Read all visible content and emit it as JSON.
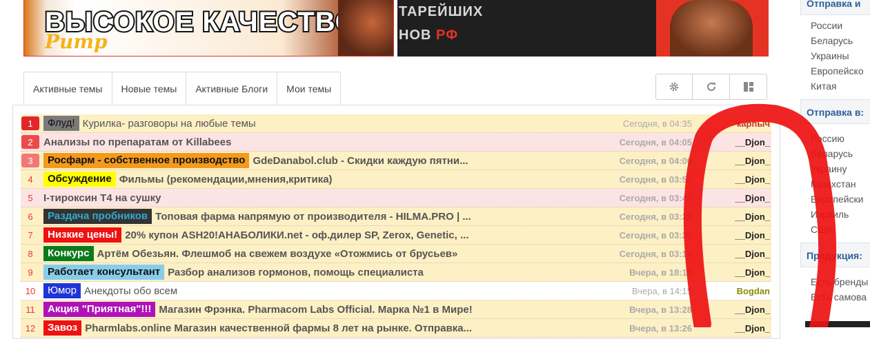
{
  "banners": {
    "left": {
      "headline": "ВЫСОКОЕ КАЧЕСТВО",
      "logo": "Pump"
    },
    "right": {
      "line1": "ТАРЕЙШИХ",
      "line2": "НОВ",
      "line2_accent": "РФ"
    }
  },
  "tabs": [
    {
      "label": "Активные темы",
      "active": true
    },
    {
      "label": "Новые темы",
      "active": false
    },
    {
      "label": "Активные Блоги",
      "active": false
    },
    {
      "label": "Мои темы",
      "active": false
    }
  ],
  "toolbar": [
    "gear-icon",
    "refresh-icon",
    "layout-icon"
  ],
  "topics": [
    {
      "num": "1",
      "num_style": "red1",
      "row": "yellow",
      "badge": "Флуд!",
      "badge_bg": "#7a7a7a",
      "badge_fg": "#111111",
      "badge_bold": false,
      "title": "Курилка- разговоры на любые темы",
      "title_bold": false,
      "time": "Сегодня, в 04:35",
      "time_bold": false,
      "user": "карпыч",
      "user_color": "#c0392b"
    },
    {
      "num": "2",
      "num_style": "red2",
      "row": "pink",
      "badge": "",
      "title": "Анализы по препаратам от Killabees",
      "title_bold": true,
      "time": "Сегодня, в 04:05",
      "time_bold": true,
      "user": "__Djon_",
      "user_color": "#222222"
    },
    {
      "num": "3",
      "num_style": "red3",
      "row": "yellow",
      "badge": "Росфарм - собственное производство",
      "badge_bg": "#f39a1e",
      "badge_fg": "#111111",
      "badge_bold": true,
      "title": "GdeDanabol.club - Скидки каждую пятни...",
      "title_bold": true,
      "time": "Сегодня, в 04:00",
      "time_bold": true,
      "user": "__Djon_",
      "user_color": "#222222"
    },
    {
      "num": "4",
      "num_style": "plain",
      "row": "yellow",
      "badge": "Обсуждение",
      "badge_bg": "#ffff00",
      "badge_fg": "#111111",
      "badge_bold": true,
      "title": "Фильмы (рекомендации,мнения,критика)",
      "title_bold": true,
      "time": "Сегодня, в 03:53",
      "time_bold": true,
      "user": "__Djon_",
      "user_color": "#222222"
    },
    {
      "num": "5",
      "num_style": "plain",
      "row": "pink",
      "badge": "",
      "title": "I-тироксин Т4 на сушку",
      "title_bold": true,
      "time": "Сегодня, в 03:48",
      "time_bold": true,
      "user": "__Djon_",
      "user_color": "#222222"
    },
    {
      "num": "6",
      "num_style": "plain",
      "row": "yellow",
      "badge": "Раздача пробников",
      "badge_bg": "#333333",
      "badge_fg": "#33aacc",
      "badge_bold": true,
      "title": "Топовая фарма напрямую от производителя - HILMA.PRO | ...",
      "title_bold": true,
      "time": "Сегодня, в 03:32",
      "time_bold": true,
      "user": "__Djon_",
      "user_color": "#222222"
    },
    {
      "num": "7",
      "num_style": "plain",
      "row": "yellow",
      "badge": "Низкие цены!",
      "badge_bg": "#ee1111",
      "badge_fg": "#ffffff",
      "badge_bold": true,
      "title": "20% купон ASH20!АНАБОЛИКИ.net - оф.дилер SP, Zerox, Genetic, ...",
      "title_bold": true,
      "time": "Сегодня, в 03:28",
      "time_bold": true,
      "user": "__Djon_",
      "user_color": "#222222"
    },
    {
      "num": "8",
      "num_style": "plain",
      "row": "yellow",
      "badge": "Конкурс",
      "badge_bg": "#0c7a1c",
      "badge_fg": "#ffffff",
      "badge_bold": true,
      "title": "Артём Обезьян. Флешмоб на свежем воздухе «Отожмись от брусьев»",
      "title_bold": true,
      "time": "Сегодня, в 03:18",
      "time_bold": true,
      "user": "__Djon_",
      "user_color": "#222222"
    },
    {
      "num": "9",
      "num_style": "plain",
      "row": "yellow",
      "badge": "Работает консультант",
      "badge_bg": "#87cdea",
      "badge_fg": "#111111",
      "badge_bold": true,
      "title": "Разбор анализов гормонов, помощь специалиста",
      "title_bold": true,
      "time": "Вчера, в 18:15",
      "time_bold": true,
      "user": "__Djon_",
      "user_color": "#222222"
    },
    {
      "num": "10",
      "num_style": "plain",
      "row": "white",
      "badge": "Юмор",
      "badge_bg": "#1f35d6",
      "badge_fg": "#ffffff",
      "badge_bold": false,
      "title": "Анекдоты обо всем",
      "title_bold": false,
      "time": "Вчера, в 14:15",
      "time_bold": false,
      "user": "Bogdan",
      "user_color": "#8b8b00"
    },
    {
      "num": "11",
      "num_style": "plain",
      "row": "yellow",
      "badge": "Акция \"Приятная\"!!!",
      "badge_bg": "#b012b8",
      "badge_fg": "#ffffff",
      "badge_bold": true,
      "title": "Магазин Фрэнка. Pharmacom Labs Official. Марка №1 в Мире!",
      "title_bold": true,
      "time": "Вчера, в 13:28",
      "time_bold": true,
      "user": "__Djon_",
      "user_color": "#222222"
    },
    {
      "num": "12",
      "num_style": "plain",
      "row": "yellow",
      "badge": "Завоз",
      "badge_bg": "#ee1111",
      "badge_fg": "#ffffff",
      "badge_bold": true,
      "title": "Pharmlabs.online Магазин качественной фармы 8 лет на рынке. Отправка...",
      "title_bold": true,
      "time": "Вчера, в 13:26",
      "time_bold": true,
      "user": "__Djon_",
      "user_color": "#222222"
    }
  ],
  "sidebar": {
    "section1": {
      "title": "Отправка и",
      "items": [
        "России",
        "Беларусь",
        "Украины",
        "Европейско",
        "Китая"
      ]
    },
    "section2": {
      "title": "Отправка в:",
      "items": [
        "Россию",
        "Беларусь",
        "Украину",
        "Казахстан",
        "Европейски",
        "Израиль",
        "США"
      ]
    },
    "section3": {
      "title": "Продукция:",
      "items": [
        "Есть бренды",
        "Есть самова"
      ]
    }
  }
}
